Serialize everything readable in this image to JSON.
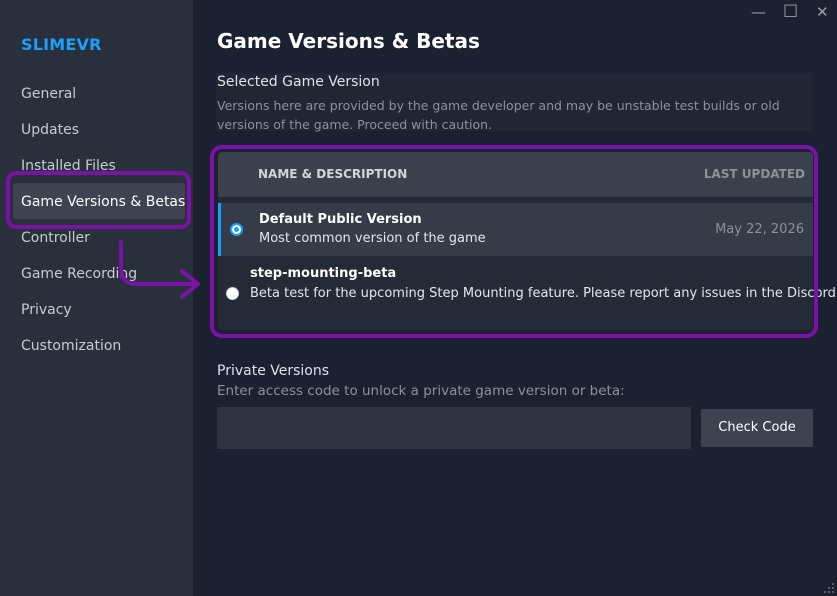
{
  "app": {
    "title": "SLIMEVR"
  },
  "window": {
    "minimize_glyph": "—",
    "maximize_glyph": "☐",
    "close_glyph": "✕"
  },
  "sidebar": {
    "items": [
      {
        "label": "General"
      },
      {
        "label": "Updates"
      },
      {
        "label": "Installed Files"
      },
      {
        "label": "Game Versions & Betas",
        "active": true
      },
      {
        "label": "Controller"
      },
      {
        "label": "Game Recording"
      },
      {
        "label": "Privacy"
      },
      {
        "label": "Customization"
      }
    ]
  },
  "main": {
    "title": "Game Versions & Betas",
    "selected_section": {
      "heading": "Selected Game Version",
      "description": "Versions here are provided by the game developer and may be unstable test builds or old versions of the game. Proceed with caution."
    },
    "table": {
      "col_name": "NAME & DESCRIPTION",
      "col_updated": "LAST UPDATED",
      "rows": [
        {
          "title": "Default Public Version",
          "description": "Most common version of the game",
          "updated": "May 22, 2026",
          "selected": true
        },
        {
          "title": "step-mounting-beta",
          "description": "Beta test for the upcoming Step Mounting feature. Please report any issues in the Discord.",
          "updated": "",
          "selected": false
        }
      ]
    },
    "private_section": {
      "heading": "Private Versions",
      "description": "Enter access code to unlock a private game version or beta:",
      "input_value": "",
      "button_label": "Check Code"
    }
  },
  "colors": {
    "accent": "#1a9fff",
    "annotation": "#7a12a8",
    "background": "#1b2130",
    "sidebar": "#2a303b"
  }
}
